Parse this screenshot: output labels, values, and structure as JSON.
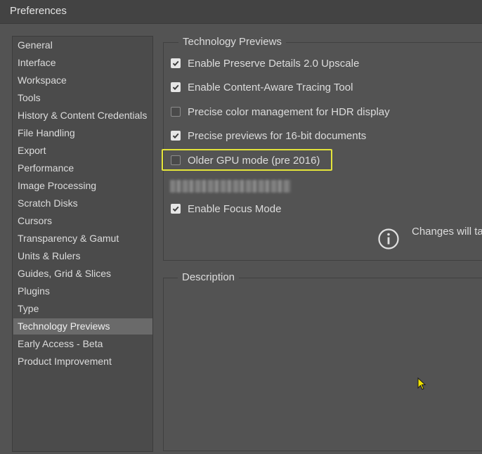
{
  "window": {
    "title": "Preferences"
  },
  "sidebar": {
    "items": [
      {
        "label": "General",
        "selected": false
      },
      {
        "label": "Interface",
        "selected": false
      },
      {
        "label": "Workspace",
        "selected": false
      },
      {
        "label": "Tools",
        "selected": false
      },
      {
        "label": "History & Content Credentials",
        "selected": false
      },
      {
        "label": "File Handling",
        "selected": false
      },
      {
        "label": "Export",
        "selected": false
      },
      {
        "label": "Performance",
        "selected": false
      },
      {
        "label": "Image Processing",
        "selected": false
      },
      {
        "label": "Scratch Disks",
        "selected": false
      },
      {
        "label": "Cursors",
        "selected": false
      },
      {
        "label": "Transparency & Gamut",
        "selected": false
      },
      {
        "label": "Units & Rulers",
        "selected": false
      },
      {
        "label": "Guides, Grid & Slices",
        "selected": false
      },
      {
        "label": "Plugins",
        "selected": false
      },
      {
        "label": "Type",
        "selected": false
      },
      {
        "label": "Technology Previews",
        "selected": true
      },
      {
        "label": "Early Access - Beta",
        "selected": false
      },
      {
        "label": "Product Improvement",
        "selected": false
      }
    ]
  },
  "tech_previews": {
    "legend": "Technology Previews",
    "options": [
      {
        "label": "Enable Preserve Details 2.0 Upscale",
        "checked": true
      },
      {
        "label": "Enable Content-Aware Tracing Tool",
        "checked": true
      },
      {
        "label": "Precise color management for HDR display",
        "checked": false
      },
      {
        "label": "Precise previews for 16-bit documents",
        "checked": true
      },
      {
        "label": "Older GPU mode (pre 2016)",
        "checked": false,
        "highlighted": true
      },
      {
        "label": "Enable Focus Mode",
        "checked": true
      }
    ],
    "info_text": "Changes will ta"
  },
  "description": {
    "legend": "Description"
  },
  "colors": {
    "highlight": "#e4e43a",
    "selected_item": "#6a6a6a",
    "panel": "#535353"
  },
  "icons": {
    "info": "info-circle-icon",
    "check": "checkmark-icon",
    "cursor": "mouse-pointer-icon"
  }
}
